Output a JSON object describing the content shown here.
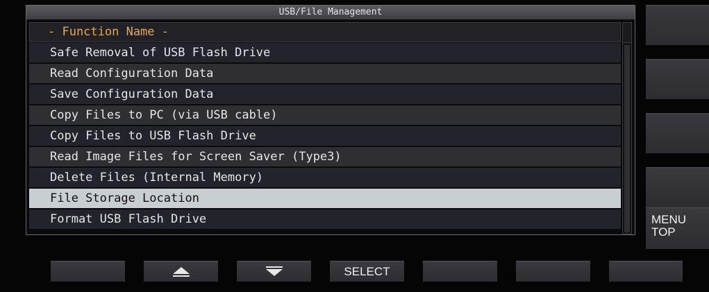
{
  "window": {
    "title": "USB/File Management"
  },
  "list": {
    "header": "- Function Name -",
    "items": [
      {
        "label": "Safe Removal of USB Flash Drive",
        "selected": false
      },
      {
        "label": "Read Configuration Data",
        "selected": false
      },
      {
        "label": "Save Configuration Data",
        "selected": false
      },
      {
        "label": "Copy Files to PC (via USB cable)",
        "selected": false
      },
      {
        "label": "Copy Files to USB Flash Drive",
        "selected": false
      },
      {
        "label": "Read Image Files for Screen Saver (Type3)",
        "selected": false
      },
      {
        "label": "Delete Files (Internal Memory)",
        "selected": false
      },
      {
        "label": "File Storage Location",
        "selected": true
      },
      {
        "label": "Format USB Flash Drive",
        "selected": false
      }
    ]
  },
  "side_buttons": [
    "",
    "",
    "",
    "",
    "MENU\nTOP"
  ],
  "bottom_buttons": [
    {
      "label": "",
      "icon": ""
    },
    {
      "label": "",
      "icon": "up-arrow-icon"
    },
    {
      "label": "",
      "icon": "down-arrow-icon"
    },
    {
      "label": "SELECT",
      "icon": ""
    },
    {
      "label": "",
      "icon": ""
    },
    {
      "label": "",
      "icon": ""
    },
    {
      "label": "",
      "icon": ""
    }
  ],
  "colors": {
    "header_text": "#e0a85a",
    "selected_row": "#c9ced3",
    "row_dark": "#23232c",
    "row_light": "#2f2f33"
  }
}
